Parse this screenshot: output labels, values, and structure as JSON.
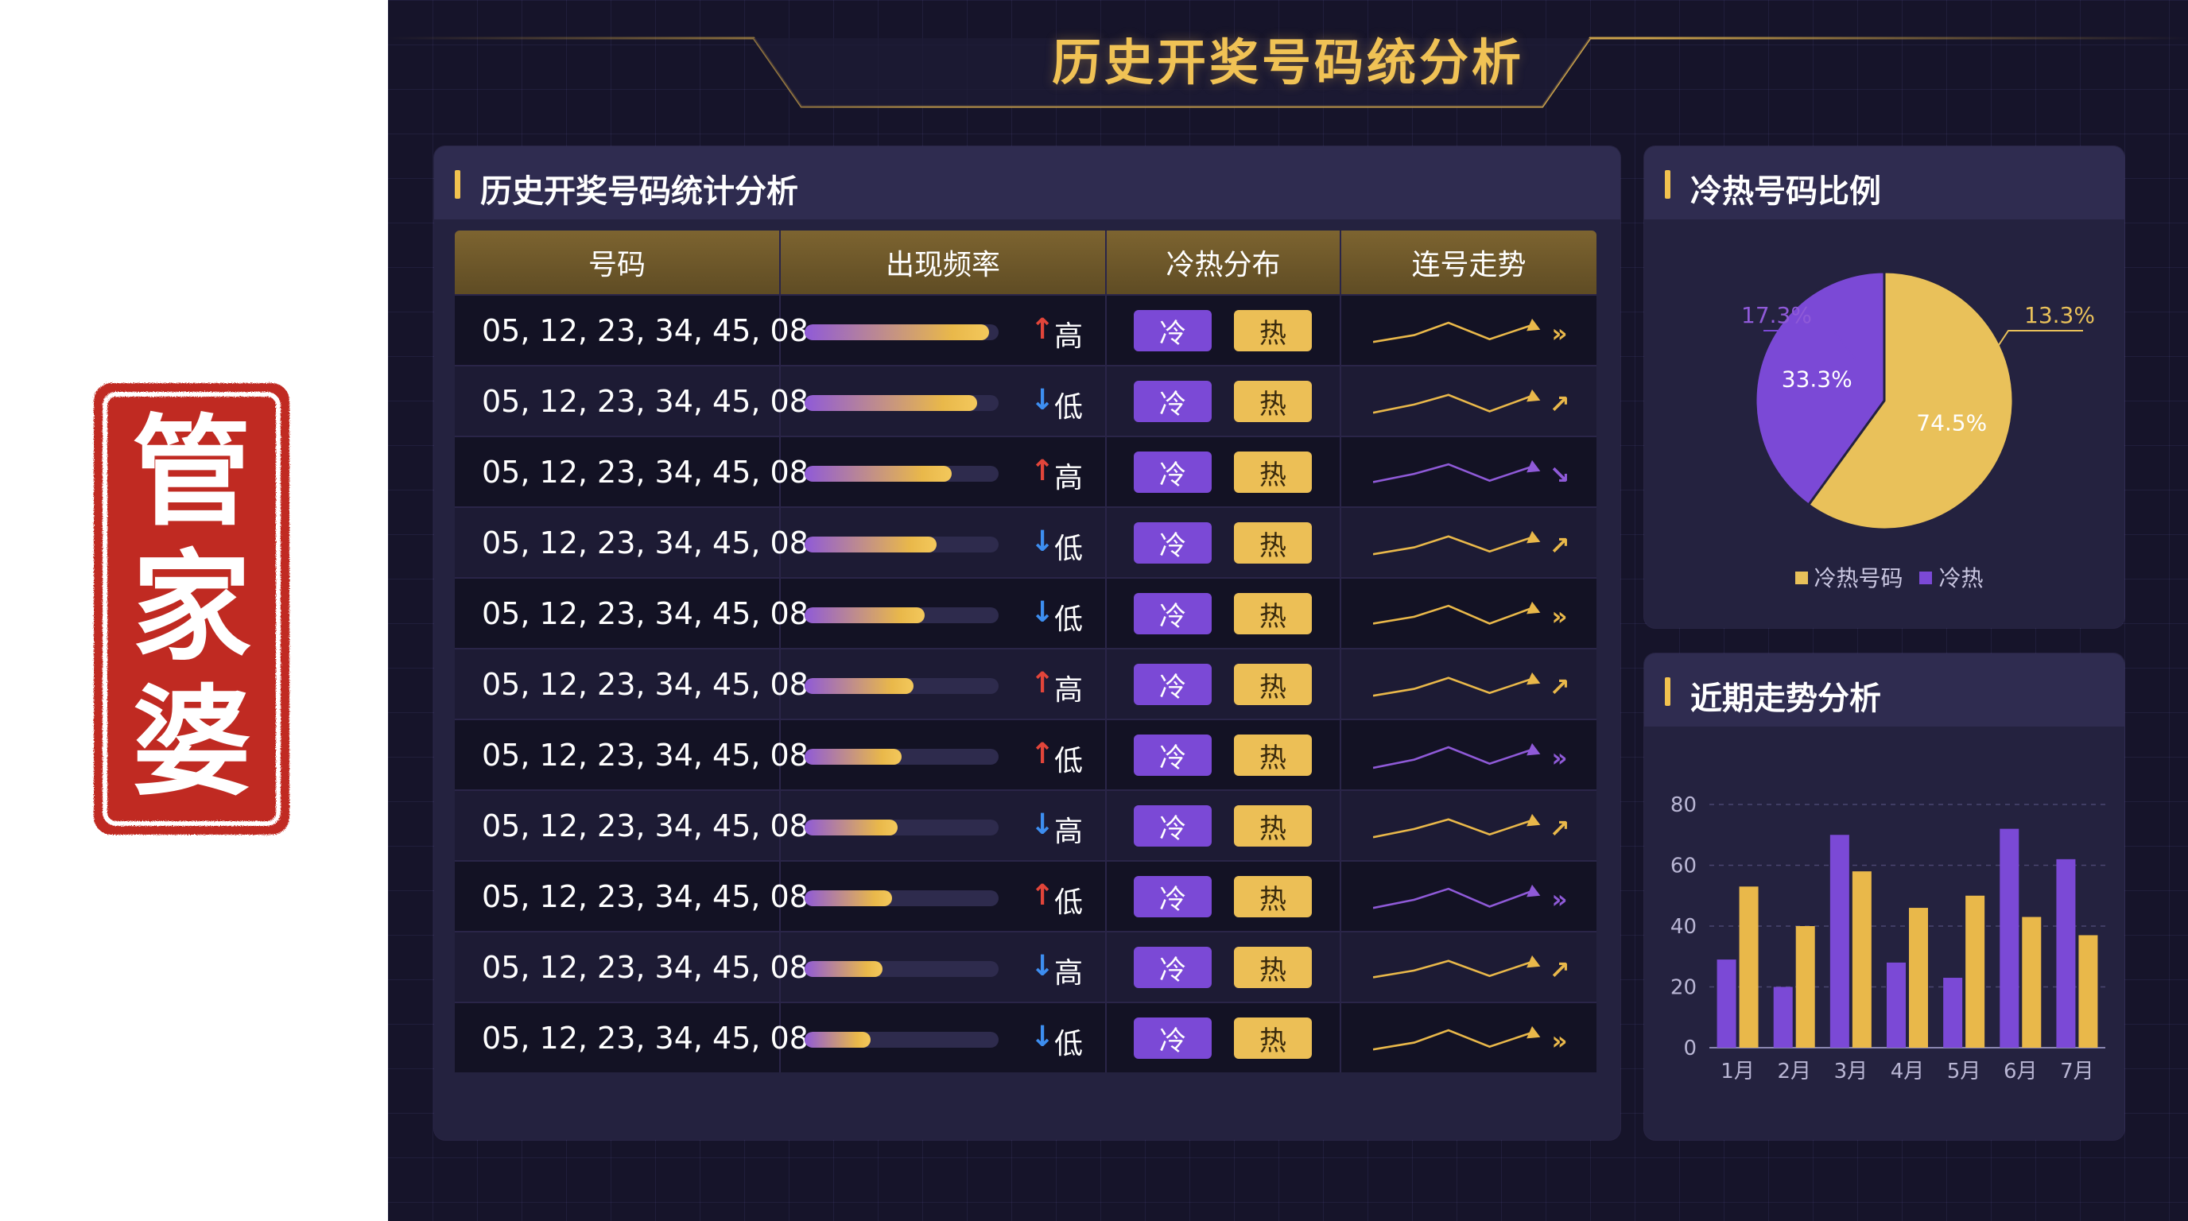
{
  "seal": {
    "text": "管家婆"
  },
  "header": {
    "title": "历史开奖号码统分析"
  },
  "table_panel": {
    "title": "历史开奖号码统计分析",
    "columns": [
      "号码",
      "出现频率",
      "冷热分布",
      "连号走势"
    ],
    "rows": [
      {
        "numbers": "05, 12, 23, 34, 45, 08",
        "frequency": 0.95,
        "arrow": "↑",
        "dir": "up",
        "level": "高",
        "cold": "冷",
        "hot": "热",
        "trend_color": "#e9b84a",
        "end_icon": "»",
        "end_icon_name": "double-chevron-right-icon"
      },
      {
        "numbers": "05, 12, 23, 34, 45, 08",
        "frequency": 0.89,
        "arrow": "↓",
        "dir": "down",
        "level": "低",
        "cold": "冷",
        "hot": "热",
        "trend_color": "#e9b84a",
        "end_icon": "↗",
        "end_icon_name": "arrow-up-right-icon"
      },
      {
        "numbers": "05, 12, 23, 34, 45, 08",
        "frequency": 0.76,
        "arrow": "↑",
        "dir": "up",
        "level": "高",
        "cold": "冷",
        "hot": "热",
        "trend_color": "#8f5ad8",
        "end_icon": "↘",
        "end_icon_name": "arrow-down-right-icon"
      },
      {
        "numbers": "05, 12, 23, 34, 45, 08",
        "frequency": 0.68,
        "arrow": "↓",
        "dir": "down",
        "level": "低",
        "cold": "冷",
        "hot": "热",
        "trend_color": "#e9b84a",
        "end_icon": "↗",
        "end_icon_name": "arrow-up-right-icon"
      },
      {
        "numbers": "05, 12, 23, 34, 45, 08",
        "frequency": 0.62,
        "arrow": "↓",
        "dir": "down",
        "level": "低",
        "cold": "冷",
        "hot": "热",
        "trend_color": "#e9b84a",
        "end_icon": "»",
        "end_icon_name": "double-chevron-right-icon"
      },
      {
        "numbers": "05, 12, 23, 34, 45, 08",
        "frequency": 0.56,
        "arrow": "↑",
        "dir": "up",
        "level": "高",
        "cold": "冷",
        "hot": "热",
        "trend_color": "#e9b84a",
        "end_icon": "↗",
        "end_icon_name": "arrow-up-right-icon"
      },
      {
        "numbers": "05, 12, 23, 34, 45, 08",
        "frequency": 0.5,
        "arrow": "↑",
        "dir": "up",
        "level": "低",
        "cold": "冷",
        "hot": "热",
        "trend_color": "#8f5ad8",
        "end_icon": "»",
        "end_icon_name": "double-chevron-right-icon"
      },
      {
        "numbers": "05, 12, 23, 34, 45, 08",
        "frequency": 0.48,
        "arrow": "↓",
        "dir": "down",
        "level": "高",
        "cold": "冷",
        "hot": "热",
        "trend_color": "#e9b84a",
        "end_icon": "↗",
        "end_icon_name": "arrow-up-right-icon"
      },
      {
        "numbers": "05, 12, 23, 34, 45, 08",
        "frequency": 0.45,
        "arrow": "↑",
        "dir": "up",
        "level": "低",
        "cold": "冷",
        "hot": "热",
        "trend_color": "#8f5ad8",
        "end_icon": "»",
        "end_icon_name": "double-chevron-right-icon"
      },
      {
        "numbers": "05, 12, 23, 34, 45, 08",
        "frequency": 0.4,
        "arrow": "↓",
        "dir": "down",
        "level": "高",
        "cold": "冷",
        "hot": "热",
        "trend_color": "#e9b84a",
        "end_icon": "↗",
        "end_icon_name": "arrow-up-right-icon"
      },
      {
        "numbers": "05, 12, 23, 34, 45, 08",
        "frequency": 0.34,
        "arrow": "↓",
        "dir": "down",
        "level": "低",
        "cold": "冷",
        "hot": "热",
        "trend_color": "#e9b84a",
        "end_icon": "»",
        "end_icon_name": "double-chevron-right-icon"
      }
    ]
  },
  "colors": {
    "gold": "#e9b84a",
    "purple": "#7b49d6",
    "up_red": "#e2453a",
    "down_blue": "#3d8ef0"
  },
  "pie_panel": {
    "title": "冷热号码比例"
  },
  "bar_panel": {
    "title": "近期走势分析"
  },
  "chart_data": [
    {
      "type": "pie",
      "slices": [
        {
          "label": "74.5%",
          "value": 60,
          "color": "#e9c15a"
        },
        {
          "label": "33.3%",
          "value": 40,
          "color": "#7b49d6"
        }
      ],
      "callouts": [
        "17.3%",
        "13.3%"
      ],
      "legend": [
        "冷热号码",
        "冷热"
      ],
      "legend_colors": [
        "#e9c15a",
        "#7b49d6"
      ]
    },
    {
      "type": "bar",
      "categories": [
        "1月",
        "2月",
        "3月",
        "4月",
        "5月",
        "6月",
        "7月"
      ],
      "series": [
        {
          "values": [
            29,
            20,
            70,
            28,
            23,
            72,
            62
          ],
          "color": "#7b49d6"
        },
        {
          "values": [
            53,
            40,
            58,
            46,
            50,
            43,
            37
          ],
          "color": "#e9b84a"
        }
      ],
      "ylim": [
        0,
        80
      ],
      "yticks": [
        0,
        20,
        40,
        60,
        80
      ],
      "grid": true
    }
  ]
}
